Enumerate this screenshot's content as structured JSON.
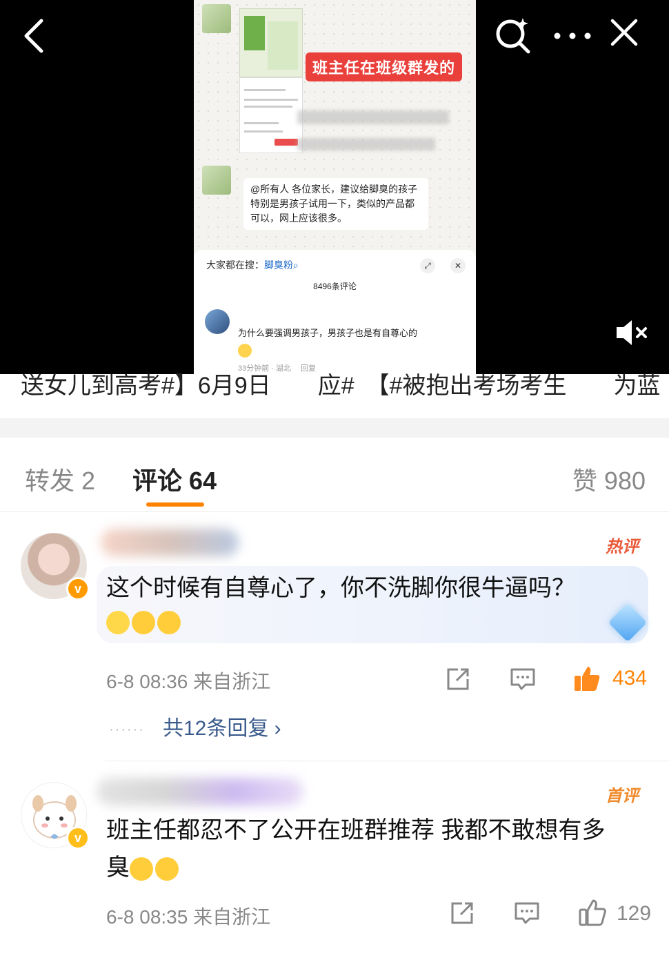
{
  "video": {
    "overlay_tag": "班主任在班级群发的",
    "message": "@所有人 各位家长，建议给脚臭的孩子特别是男孩子试用一下，类似的产品都可以，网上应该很多。",
    "sheet": {
      "search_prefix": "大家都在搜：",
      "search_keyword": "脚臭粉",
      "comment_count": "8496条评论",
      "comment_text": "为什么要强调男孩子，男孩子也是有自尊心的",
      "comment_meta": "33分钟前 · 湖北 　回复"
    },
    "icons": [
      "back-icon",
      "search-icon",
      "more-icon",
      "close-icon",
      "mute-icon"
    ]
  },
  "caption": "送女儿到高考#】6月9日　　应#　【#被抱出考场考生　　为蓝",
  "tabs": {
    "repost": "转发 2",
    "comment": "评论 64",
    "like": "赞 980"
  },
  "colors": {
    "accent": "#ff8200",
    "reply_link": "#3a5a8c",
    "hot": "#ea5a3a"
  },
  "comments": [
    {
      "tag": "热评",
      "line1": "这个时候有自尊心了，你不洗脚你很牛逼吗？",
      "time": "6-8 08:36",
      "location": "来自浙江",
      "likes": "434",
      "replies": "共12条回复"
    },
    {
      "tag": "首评",
      "line1": "班主任都忍不了公开在班群推荐 我都不敢想有多",
      "line2": "臭",
      "time": "6-8 08:35",
      "location": "来自浙江",
      "likes": "129"
    }
  ]
}
